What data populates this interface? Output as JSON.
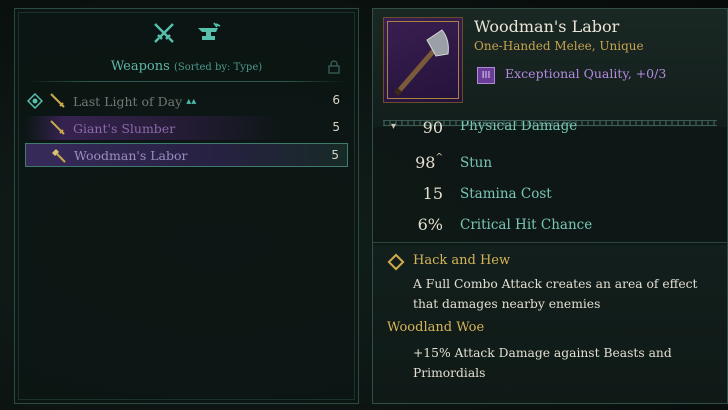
{
  "inventory": {
    "title": "Weapons",
    "sort_label": "(Sorted by: Type)",
    "tab_icons": [
      "crossed-swords-icon",
      "anvil-icon"
    ],
    "weapons": [
      {
        "name": "Last Light of Day",
        "count": "6",
        "equipped": true
      },
      {
        "name": "Giant's Slumber",
        "count": "5",
        "equipped": false
      },
      {
        "name": "Woodman's Labor",
        "count": "5",
        "equipped": false,
        "selected": true
      }
    ]
  },
  "item": {
    "name": "Woodman's Labor",
    "type": "One-Handed Melee, Unique",
    "quality_badge": "III",
    "quality": "Exceptional Quality, +0/3",
    "stats": [
      {
        "value": "90",
        "label": "Physical Damage"
      },
      {
        "value": "98",
        "sup": "^",
        "label": "Stun"
      },
      {
        "value": "15",
        "label": "Stamina Cost"
      },
      {
        "value": "6%",
        "label": "Critical Hit Chance"
      }
    ],
    "perks": [
      {
        "title": "Hack and Hew",
        "description": "A Full Combo Attack creates an area of effect that damages nearby enemies"
      },
      {
        "title": "Woodland Woe",
        "description": "+15% Attack Damage against Beasts and Primordials"
      }
    ]
  },
  "colors": {
    "accent_teal": "#5fb6a6",
    "gold": "#d4b55a",
    "unique_purple": "#b48be0"
  }
}
